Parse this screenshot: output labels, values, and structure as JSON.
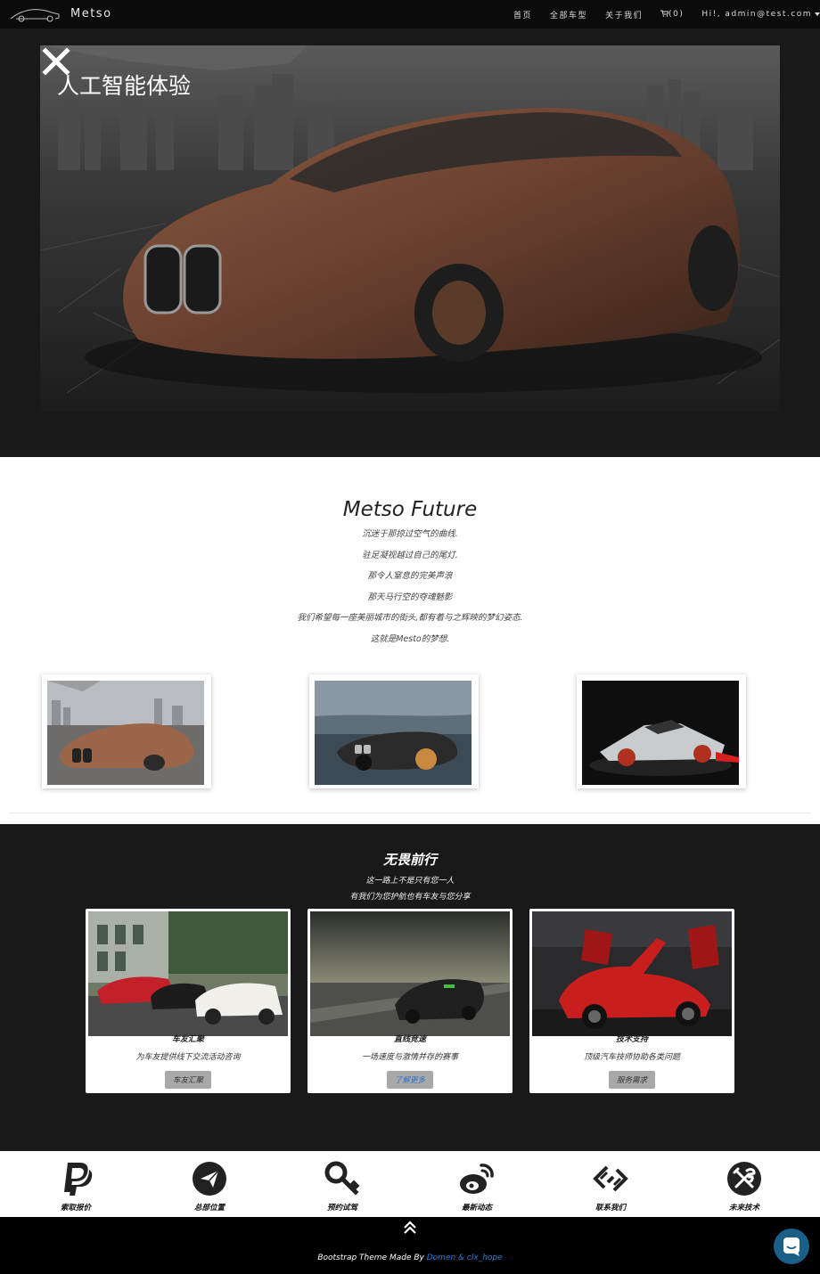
{
  "nav": {
    "brand": "Metso",
    "links": [
      "首页",
      "全部车型",
      "关于我们"
    ],
    "cart": "(0)",
    "user": "Hi!, admin@test.com"
  },
  "hero": {
    "title": "人工智能体验"
  },
  "future": {
    "title": "Metso Future",
    "lines": [
      "沉迷于那掠过空气的曲线.",
      "驻足凝视越过自己的尾灯.",
      "那令人窒息的完美声浪",
      "那天马行空的夺魂魅影",
      "我们希望每一座美丽城市的街头,都有着与之辉映的梦幻姿态.",
      "这就是Mesto的梦想."
    ]
  },
  "community": {
    "title": "无畏前行",
    "subtitle_1": "这一路上不是只有您一人",
    "subtitle_2": "有我们为您护航也有车友与您分享",
    "cards": [
      {
        "title": "车友汇聚",
        "desc": "为车友提供线下交流活动咨询",
        "button": "车友汇聚"
      },
      {
        "title": "直线竞速",
        "desc": "一场速度与激情并存的赛事",
        "button": "了解更多"
      },
      {
        "title": "技术支持",
        "desc": "顶级汽车技师协助各类问题",
        "button": "服务需求"
      }
    ]
  },
  "services": [
    {
      "label": "索取报价",
      "icon": "paypal-icon"
    },
    {
      "label": "总部位置",
      "icon": "location-arrow-icon"
    },
    {
      "label": "预约试驾",
      "icon": "key-icon"
    },
    {
      "label": "最新动态",
      "icon": "weibo-icon"
    },
    {
      "label": "联系我们",
      "icon": "link-icon"
    },
    {
      "label": "未来技术",
      "icon": "tools-icon"
    }
  ],
  "footer": {
    "prefix": "Bootstrap Theme Made By",
    "authors": "Domen & clx_hope"
  },
  "colors": {
    "nav_bg": "#0b0b0b",
    "dark_bg": "#191919",
    "button_gray": "#a9a9a9",
    "link_blue": "#2a7fd9",
    "chat_blue": "#1a5f87"
  }
}
